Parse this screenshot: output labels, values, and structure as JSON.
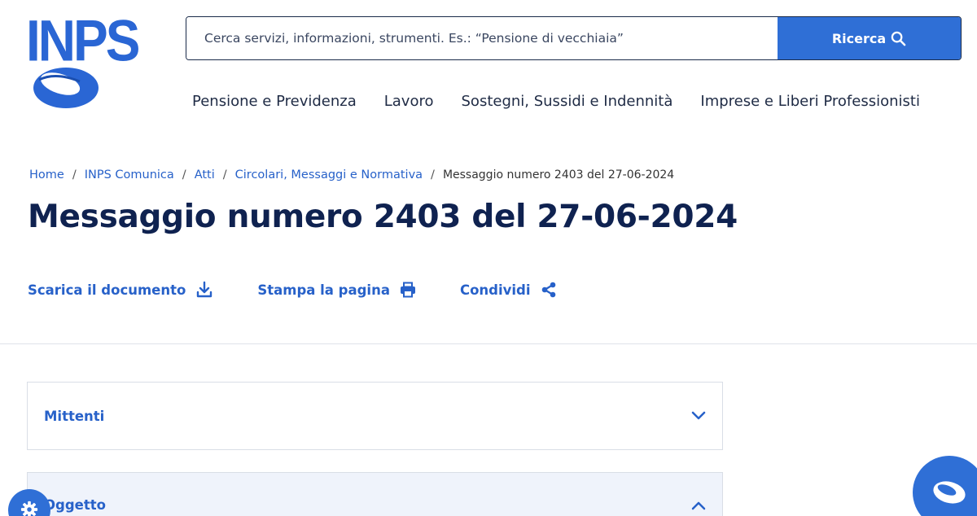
{
  "header": {
    "logo_text": "INPS",
    "search": {
      "placeholder": "Cerca servizi, informazioni, strumenti. Es.: “Pensione di vecchiaia”",
      "button_label": "Ricerca"
    },
    "nav": [
      {
        "label": "Pensione e Previdenza"
      },
      {
        "label": "Lavoro"
      },
      {
        "label": "Sostegni, Sussidi e Indennità"
      },
      {
        "label": "Imprese e Liberi Professionisti"
      }
    ]
  },
  "breadcrumb": {
    "items": [
      {
        "label": "Home"
      },
      {
        "label": "INPS Comunica"
      },
      {
        "label": "Atti"
      },
      {
        "label": "Circolari, Messaggi e Normativa"
      }
    ],
    "separator": "/",
    "current": "Messaggio numero 2403 del 27-06-2024"
  },
  "page": {
    "title": "Messaggio numero 2403 del 27-06-2024"
  },
  "actions": {
    "download_label": "Scarica il documento",
    "print_label": "Stampa la pagina",
    "share_label": "Condividi"
  },
  "accordion": [
    {
      "label": "Mittenti",
      "expanded": false
    },
    {
      "label": "Oggetto",
      "expanded": true
    }
  ],
  "colors": {
    "brand_blue": "#2f6fd6",
    "link_blue": "#2761c9",
    "title_navy": "#0f2250"
  },
  "icons": {
    "search": "search-icon",
    "download": "download-icon",
    "print": "printer-icon",
    "share": "share-icon",
    "chevron_down": "chevron-down-icon",
    "chevron_up": "chevron-up-icon",
    "settings": "gear-icon",
    "assistant": "inps-logo-icon"
  }
}
